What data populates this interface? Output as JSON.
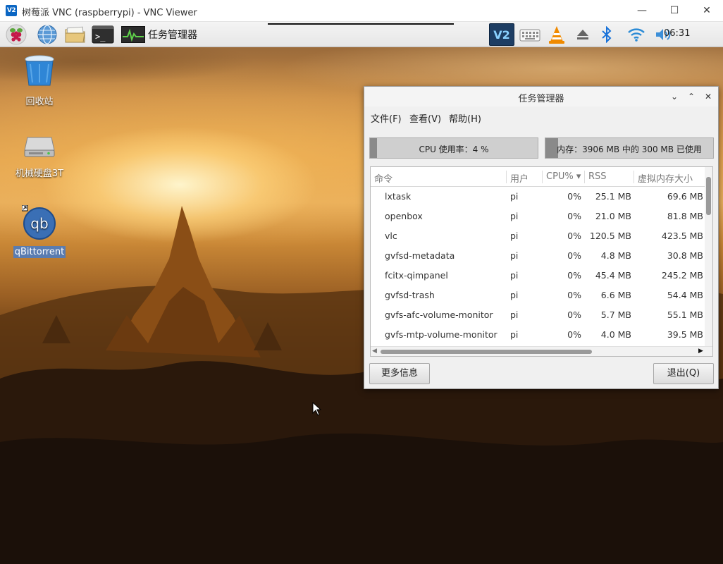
{
  "vnc_window": {
    "icon_text": "V2",
    "title": "树莓派 VNC (raspberrypi) - VNC Viewer",
    "minimize": "—",
    "maximize": "☐",
    "close": "✕"
  },
  "panel": {
    "taskbar_item": "任务管理器",
    "tray_vnc_text": "V2",
    "clock": "06:31"
  },
  "desktop": {
    "icons": [
      {
        "label": "回收站"
      },
      {
        "label": "机械硬盘3T"
      },
      {
        "label": "qBittorrent"
      }
    ]
  },
  "task_manager": {
    "title": "任务管理器",
    "controls": {
      "shade": "⌄",
      "maximize": "⌃",
      "close": "✕"
    },
    "menu": {
      "file": "文件(F)",
      "view": "查看(V)",
      "help": "帮助(H)"
    },
    "cpu_label": "CPU 使用率：4 %",
    "cpu_percent": 4,
    "mem_label": "内存：3906 MB 中的 300 MB 已使用",
    "mem_used_mb": 300,
    "mem_total_mb": 3906,
    "columns": {
      "name": "命令",
      "user": "用户",
      "cpu": "CPU% ▾",
      "rss": "RSS",
      "virt": "虚拟内存大小"
    },
    "processes": [
      {
        "name": "lxtask",
        "user": "pi",
        "cpu": "0%",
        "rss": "25.1 MB",
        "virt": "69.6 MB"
      },
      {
        "name": "openbox",
        "user": "pi",
        "cpu": "0%",
        "rss": "21.0 MB",
        "virt": "81.8 MB"
      },
      {
        "name": "vlc",
        "user": "pi",
        "cpu": "0%",
        "rss": "120.5 MB",
        "virt": "423.5 MB"
      },
      {
        "name": "gvfsd-metadata",
        "user": "pi",
        "cpu": "0%",
        "rss": "4.8 MB",
        "virt": "30.8 MB"
      },
      {
        "name": "fcitx-qimpanel",
        "user": "pi",
        "cpu": "0%",
        "rss": "45.4 MB",
        "virt": "245.2 MB"
      },
      {
        "name": "gvfsd-trash",
        "user": "pi",
        "cpu": "0%",
        "rss": "6.6 MB",
        "virt": "54.4 MB"
      },
      {
        "name": "gvfs-afc-volume-monitor",
        "user": "pi",
        "cpu": "0%",
        "rss": "5.7 MB",
        "virt": "55.1 MB"
      },
      {
        "name": "gvfs-mtp-volume-monitor",
        "user": "pi",
        "cpu": "0%",
        "rss": "4.0 MB",
        "virt": "39.5 MB"
      }
    ],
    "buttons": {
      "more_info": "更多信息",
      "quit": "退出(Q)"
    }
  }
}
